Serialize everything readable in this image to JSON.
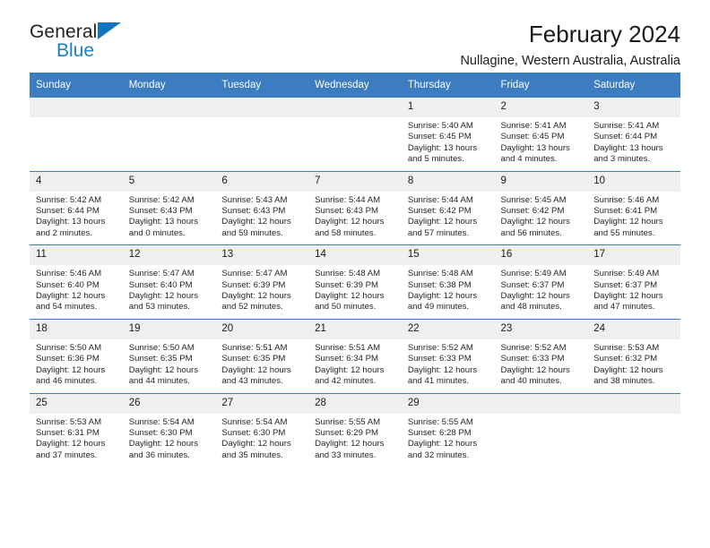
{
  "brand": {
    "name_top": "General",
    "name_bottom": "Blue",
    "triangle_color": "#1175c0",
    "bottom_color": "#1f7ec4"
  },
  "header": {
    "title": "February 2024",
    "subtitle": "Nullagine, Western Australia, Australia"
  },
  "theme": {
    "header_blue": "#3c7cc0",
    "daynum_gray": "#efefef",
    "text": "#1a1a1a"
  },
  "weekday_headers": [
    "Sunday",
    "Monday",
    "Tuesday",
    "Wednesday",
    "Thursday",
    "Friday",
    "Saturday"
  ],
  "labels": {
    "sunrise_prefix": "Sunrise:",
    "sunset_prefix": "Sunset:",
    "daylight_prefix": "Daylight:"
  },
  "weeks": [
    [
      {
        "day": "",
        "blank": true
      },
      {
        "day": "",
        "blank": true
      },
      {
        "day": "",
        "blank": true
      },
      {
        "day": "",
        "blank": true
      },
      {
        "day": "1",
        "sunrise": "Sunrise: 5:40 AM",
        "sunset": "Sunset: 6:45 PM",
        "daylight": "Daylight: 13 hours and 5 minutes."
      },
      {
        "day": "2",
        "sunrise": "Sunrise: 5:41 AM",
        "sunset": "Sunset: 6:45 PM",
        "daylight": "Daylight: 13 hours and 4 minutes."
      },
      {
        "day": "3",
        "sunrise": "Sunrise: 5:41 AM",
        "sunset": "Sunset: 6:44 PM",
        "daylight": "Daylight: 13 hours and 3 minutes."
      }
    ],
    [
      {
        "day": "4",
        "sunrise": "Sunrise: 5:42 AM",
        "sunset": "Sunset: 6:44 PM",
        "daylight": "Daylight: 13 hours and 2 minutes."
      },
      {
        "day": "5",
        "sunrise": "Sunrise: 5:42 AM",
        "sunset": "Sunset: 6:43 PM",
        "daylight": "Daylight: 13 hours and 0 minutes."
      },
      {
        "day": "6",
        "sunrise": "Sunrise: 5:43 AM",
        "sunset": "Sunset: 6:43 PM",
        "daylight": "Daylight: 12 hours and 59 minutes."
      },
      {
        "day": "7",
        "sunrise": "Sunrise: 5:44 AM",
        "sunset": "Sunset: 6:43 PM",
        "daylight": "Daylight: 12 hours and 58 minutes."
      },
      {
        "day": "8",
        "sunrise": "Sunrise: 5:44 AM",
        "sunset": "Sunset: 6:42 PM",
        "daylight": "Daylight: 12 hours and 57 minutes."
      },
      {
        "day": "9",
        "sunrise": "Sunrise: 5:45 AM",
        "sunset": "Sunset: 6:42 PM",
        "daylight": "Daylight: 12 hours and 56 minutes."
      },
      {
        "day": "10",
        "sunrise": "Sunrise: 5:46 AM",
        "sunset": "Sunset: 6:41 PM",
        "daylight": "Daylight: 12 hours and 55 minutes."
      }
    ],
    [
      {
        "day": "11",
        "sunrise": "Sunrise: 5:46 AM",
        "sunset": "Sunset: 6:40 PM",
        "daylight": "Daylight: 12 hours and 54 minutes."
      },
      {
        "day": "12",
        "sunrise": "Sunrise: 5:47 AM",
        "sunset": "Sunset: 6:40 PM",
        "daylight": "Daylight: 12 hours and 53 minutes."
      },
      {
        "day": "13",
        "sunrise": "Sunrise: 5:47 AM",
        "sunset": "Sunset: 6:39 PM",
        "daylight": "Daylight: 12 hours and 52 minutes."
      },
      {
        "day": "14",
        "sunrise": "Sunrise: 5:48 AM",
        "sunset": "Sunset: 6:39 PM",
        "daylight": "Daylight: 12 hours and 50 minutes."
      },
      {
        "day": "15",
        "sunrise": "Sunrise: 5:48 AM",
        "sunset": "Sunset: 6:38 PM",
        "daylight": "Daylight: 12 hours and 49 minutes."
      },
      {
        "day": "16",
        "sunrise": "Sunrise: 5:49 AM",
        "sunset": "Sunset: 6:37 PM",
        "daylight": "Daylight: 12 hours and 48 minutes."
      },
      {
        "day": "17",
        "sunrise": "Sunrise: 5:49 AM",
        "sunset": "Sunset: 6:37 PM",
        "daylight": "Daylight: 12 hours and 47 minutes."
      }
    ],
    [
      {
        "day": "18",
        "sunrise": "Sunrise: 5:50 AM",
        "sunset": "Sunset: 6:36 PM",
        "daylight": "Daylight: 12 hours and 46 minutes."
      },
      {
        "day": "19",
        "sunrise": "Sunrise: 5:50 AM",
        "sunset": "Sunset: 6:35 PM",
        "daylight": "Daylight: 12 hours and 44 minutes."
      },
      {
        "day": "20",
        "sunrise": "Sunrise: 5:51 AM",
        "sunset": "Sunset: 6:35 PM",
        "daylight": "Daylight: 12 hours and 43 minutes."
      },
      {
        "day": "21",
        "sunrise": "Sunrise: 5:51 AM",
        "sunset": "Sunset: 6:34 PM",
        "daylight": "Daylight: 12 hours and 42 minutes."
      },
      {
        "day": "22",
        "sunrise": "Sunrise: 5:52 AM",
        "sunset": "Sunset: 6:33 PM",
        "daylight": "Daylight: 12 hours and 41 minutes."
      },
      {
        "day": "23",
        "sunrise": "Sunrise: 5:52 AM",
        "sunset": "Sunset: 6:33 PM",
        "daylight": "Daylight: 12 hours and 40 minutes."
      },
      {
        "day": "24",
        "sunrise": "Sunrise: 5:53 AM",
        "sunset": "Sunset: 6:32 PM",
        "daylight": "Daylight: 12 hours and 38 minutes."
      }
    ],
    [
      {
        "day": "25",
        "sunrise": "Sunrise: 5:53 AM",
        "sunset": "Sunset: 6:31 PM",
        "daylight": "Daylight: 12 hours and 37 minutes."
      },
      {
        "day": "26",
        "sunrise": "Sunrise: 5:54 AM",
        "sunset": "Sunset: 6:30 PM",
        "daylight": "Daylight: 12 hours and 36 minutes."
      },
      {
        "day": "27",
        "sunrise": "Sunrise: 5:54 AM",
        "sunset": "Sunset: 6:30 PM",
        "daylight": "Daylight: 12 hours and 35 minutes."
      },
      {
        "day": "28",
        "sunrise": "Sunrise: 5:55 AM",
        "sunset": "Sunset: 6:29 PM",
        "daylight": "Daylight: 12 hours and 33 minutes."
      },
      {
        "day": "29",
        "sunrise": "Sunrise: 5:55 AM",
        "sunset": "Sunset: 6:28 PM",
        "daylight": "Daylight: 12 hours and 32 minutes."
      },
      {
        "day": "",
        "blank": true
      },
      {
        "day": "",
        "blank": true
      }
    ]
  ]
}
